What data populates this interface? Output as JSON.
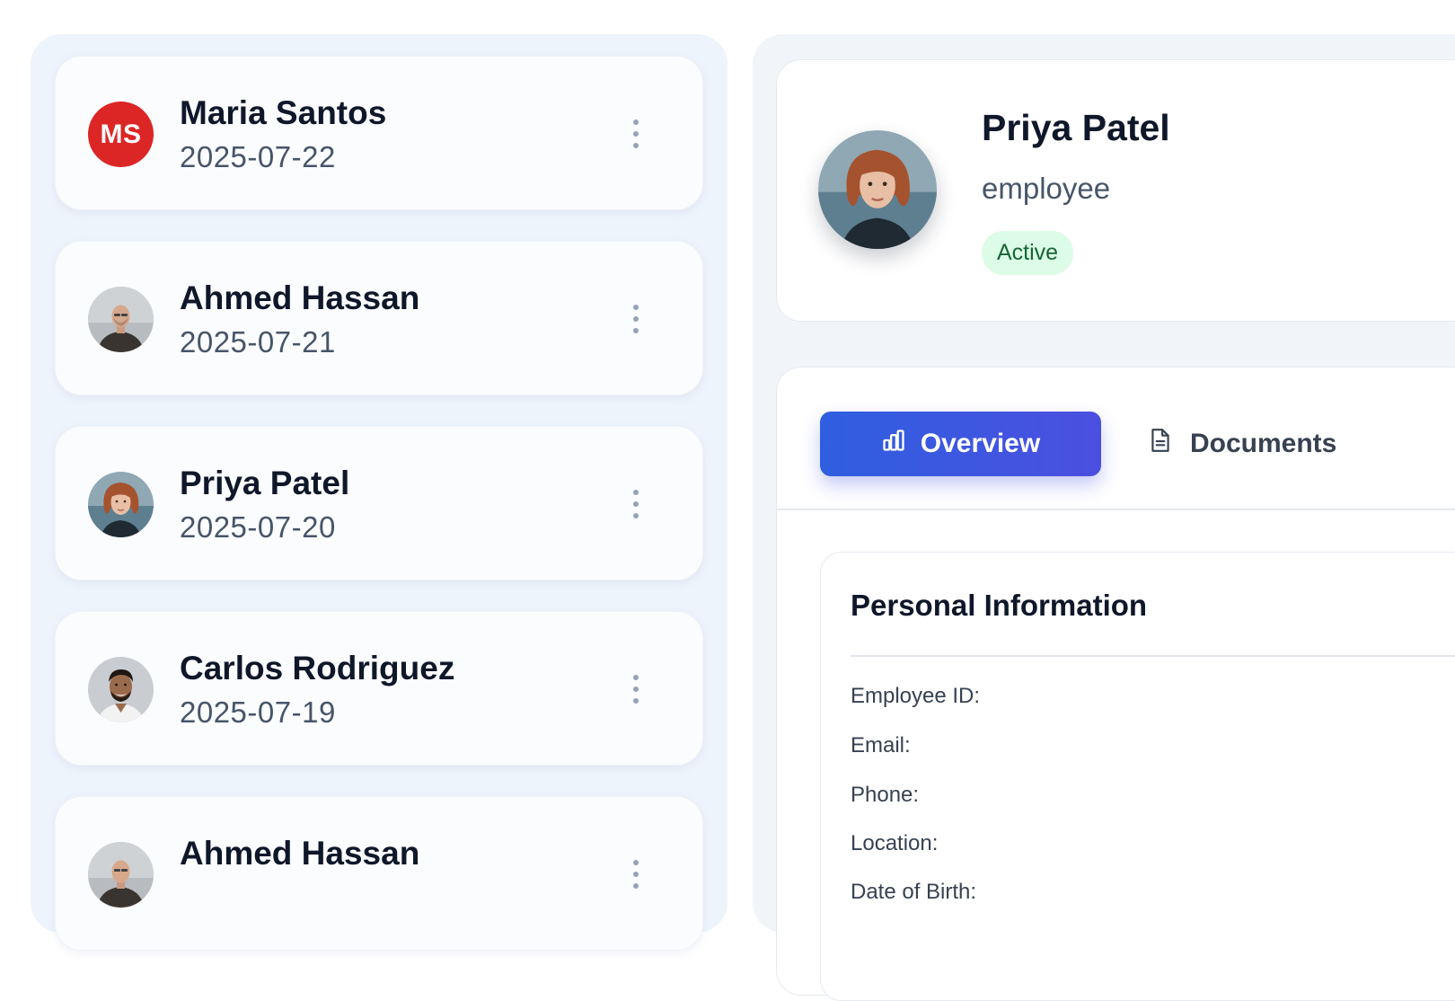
{
  "employees": [
    {
      "name": "Maria Santos",
      "date": "2025-07-22",
      "initials": "MS",
      "avatar_type": "initials"
    },
    {
      "name": "Ahmed Hassan",
      "date": "2025-07-21",
      "avatar_type": "photo"
    },
    {
      "name": "Priya Patel",
      "date": "2025-07-20",
      "avatar_type": "photo"
    },
    {
      "name": "Carlos Rodriguez",
      "date": "2025-07-19",
      "avatar_type": "photo"
    },
    {
      "name": "Ahmed Hassan",
      "date": "",
      "avatar_type": "photo"
    }
  ],
  "profile": {
    "name": "Priya Patel",
    "role": "employee",
    "status": "Active"
  },
  "tabs": {
    "overview": {
      "label": "Overview",
      "icon": "bar-chart-icon",
      "active": true
    },
    "documents": {
      "label": "Documents",
      "icon": "document-icon",
      "active": false
    }
  },
  "personal_info": {
    "title": "Personal Information",
    "labels": [
      "Employee ID:",
      "Email:",
      "Phone:",
      "Location:",
      "Date of Birth:"
    ]
  },
  "colors": {
    "accent": "#3b5be0",
    "initials_avatar": "#dc2626",
    "status_bg": "#dcfce7",
    "status_text": "#166534"
  }
}
